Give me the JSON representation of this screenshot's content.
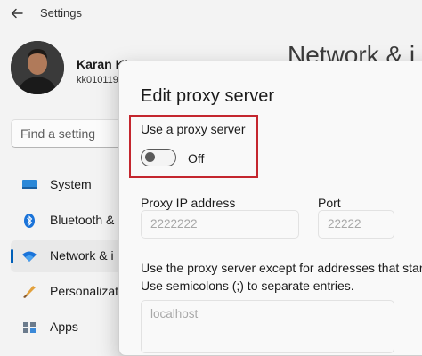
{
  "app": {
    "title": "Settings",
    "back_icon": "arrow-left-icon"
  },
  "user": {
    "name": "Karan Kl",
    "id": "kk010119"
  },
  "search": {
    "placeholder": "Find a setting",
    "icon": "search-icon"
  },
  "nav": {
    "items": [
      {
        "label": "System",
        "icon": "display-icon",
        "active": false
      },
      {
        "label": "Bluetooth &",
        "icon": "bluetooth-icon",
        "active": false
      },
      {
        "label": "Network & i",
        "icon": "wifi-icon",
        "active": true
      },
      {
        "label": "Personalizat",
        "icon": "brush-icon",
        "active": false
      },
      {
        "label": "Apps",
        "icon": "apps-icon",
        "active": false
      }
    ]
  },
  "page": {
    "heading": "Network & i"
  },
  "dialog": {
    "title": "Edit proxy server",
    "use_proxy_label": "Use a proxy server",
    "toggle_state": "Off",
    "toggle_on": false,
    "proxy_ip_label": "Proxy IP address",
    "proxy_ip_placeholder": "2222222",
    "port_label": "Port",
    "port_placeholder": "22222",
    "exceptions_line1": "Use the proxy server except for addresses that star",
    "exceptions_line2": "Use semicolons (;) to separate entries.",
    "exceptions_placeholder": "localhost"
  },
  "colors": {
    "accent": "#005fb8",
    "highlight": "#c4262e"
  }
}
